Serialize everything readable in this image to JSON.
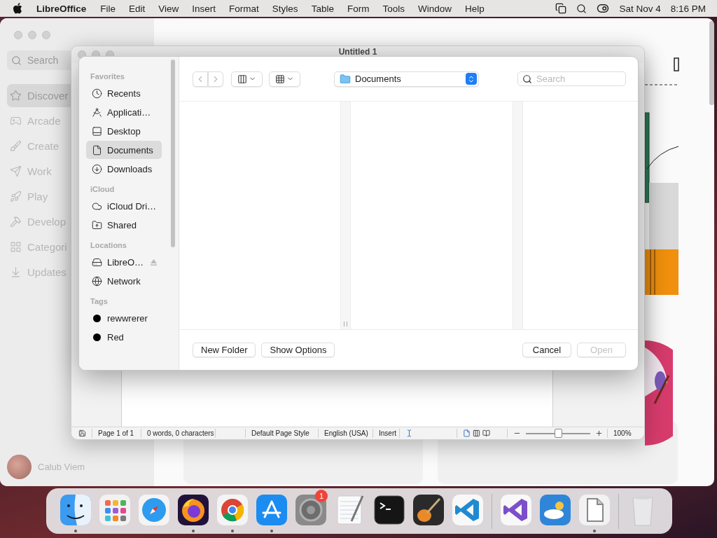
{
  "menu_bar": {
    "app_name": "LibreOffice",
    "menus": [
      "File",
      "Edit",
      "View",
      "Insert",
      "Format",
      "Styles",
      "Table",
      "Form",
      "Tools",
      "Window",
      "Help"
    ],
    "date": "Sat Nov 4",
    "time": "8:16 PM"
  },
  "app_store_window": {
    "search_placeholder": "Search",
    "nav": [
      {
        "label": "Discover",
        "selected": true
      },
      {
        "label": "Arcade",
        "selected": false
      },
      {
        "label": "Create",
        "selected": false
      },
      {
        "label": "Work",
        "selected": false
      },
      {
        "label": "Play",
        "selected": false
      },
      {
        "label": "Develop",
        "selected": false
      },
      {
        "label": "Categori",
        "selected": false
      },
      {
        "label": "Updates",
        "selected": false
      }
    ],
    "account": "Calub Viem"
  },
  "document_window": {
    "title": "Untitled 1",
    "status_bar": {
      "page": "Page 1 of 1",
      "word_count": "0 words, 0 characters",
      "page_style": "Default Page Style",
      "language": "English (USA)",
      "input_mode": "Insert",
      "zoom": {
        "level": 0.5,
        "reading": "100%"
      }
    }
  },
  "open_dialog": {
    "toolbar": {
      "location": "Documents",
      "search_placeholder": "Search"
    },
    "sidebar": [
      {
        "heading": "Favorites",
        "kind": "places",
        "items": [
          {
            "label": "Recents",
            "selected": false
          },
          {
            "label": "Applicati…",
            "selected": false
          },
          {
            "label": "Desktop",
            "selected": false
          },
          {
            "label": "Documents",
            "selected": true
          },
          {
            "label": "Downloads",
            "selected": false
          }
        ]
      },
      {
        "heading": "iCloud",
        "kind": "places",
        "items": [
          {
            "label": "iCloud Dri…",
            "selected": false
          },
          {
            "label": "Shared",
            "selected": false
          }
        ]
      },
      {
        "heading": "Locations",
        "kind": "places",
        "items": [
          {
            "label": "LibreO…",
            "selected": false,
            "ejectable": true
          },
          {
            "label": "Network",
            "selected": false,
            "ejectable": false
          }
        ]
      },
      {
        "heading": "Tags",
        "kind": "tags",
        "items": [
          {
            "label": "rewwrerer",
            "selected": false,
            "color": "#000000"
          },
          {
            "label": "Red",
            "selected": false,
            "color": "#000000"
          }
        ]
      }
    ],
    "buttons": [
      {
        "label": "New Folder",
        "disabled": false
      },
      {
        "label": "Show Options",
        "disabled": false
      },
      {
        "label": "Cancel",
        "disabled": false
      },
      {
        "label": "Open",
        "disabled": true
      }
    ]
  },
  "dock": {
    "groups": [
      [
        {
          "running": true
        },
        {
          "running": false
        },
        {
          "running": false
        },
        {
          "running": true
        },
        {
          "running": true
        },
        {
          "running": true
        },
        {
          "running": false,
          "badge": "1"
        },
        {
          "running": false
        },
        {
          "running": false
        },
        {
          "running": false
        },
        {
          "running": false
        }
      ],
      [
        {
          "running": false
        },
        {
          "running": false
        },
        {
          "running": true
        }
      ],
      [
        {
          "running": false
        }
      ]
    ]
  }
}
